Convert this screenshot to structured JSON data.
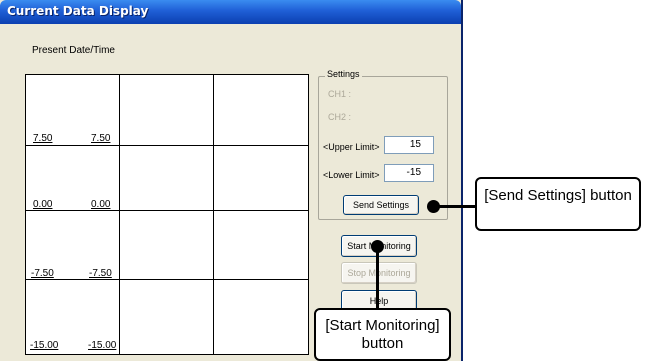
{
  "window": {
    "title": "Current Data Display"
  },
  "graph": {
    "header_label": "Present Date/Time",
    "y_labels": [
      {
        "left": "7.50",
        "right": "7.50"
      },
      {
        "left": "0.00",
        "right": "0.00"
      },
      {
        "left": "-7.50",
        "right": "-7.50"
      },
      {
        "left": "-15.00",
        "right": "-15.00"
      }
    ]
  },
  "settings": {
    "legend": "Settings",
    "ch1": "CH1  :",
    "ch2": "CH2  :",
    "upper_label": "<Upper Limit>",
    "upper_value": "15",
    "lower_label": "<Lower Limit>",
    "lower_value": "-15",
    "send_button": "Send Settings"
  },
  "buttons": {
    "start": "Start Monitoring",
    "stop": "Stop Monitoring",
    "help": "Help"
  },
  "callouts": {
    "send": "[Send Settings] button",
    "start": "[Start Monitoring] button"
  }
}
